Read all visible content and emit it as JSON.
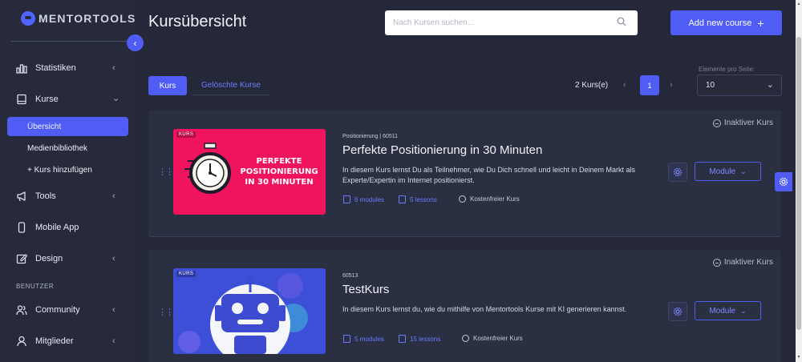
{
  "sidebar": {
    "logo": "MENTORTOOLS",
    "collapse_icon": "‹",
    "items": [
      {
        "label": "Statistiken",
        "icon": "bar-chart-icon",
        "chevron": "‹"
      },
      {
        "label": "Kurse",
        "icon": "book-icon",
        "chevron": "⌄"
      },
      {
        "label": "Tools",
        "icon": "megaphone-icon",
        "chevron": "‹"
      },
      {
        "label": "Mobile App",
        "icon": "smartphone-icon",
        "chevron": ""
      },
      {
        "label": "Design",
        "icon": "edit-icon",
        "chevron": "‹"
      },
      {
        "label": "Community",
        "icon": "users-icon",
        "chevron": "‹"
      },
      {
        "label": "Mitglieder",
        "icon": "user-icon",
        "chevron": "‹"
      }
    ],
    "sub_items": [
      {
        "label": "Übersicht"
      },
      {
        "label": "Medienbibliothek"
      },
      {
        "label": "+ Kurs hinzufügen"
      }
    ],
    "section_benutzer": "BENUTZER"
  },
  "header": {
    "title": "Kursübersicht",
    "search_placeholder": "Nach Kursen suchen...",
    "add_button": "Add new course",
    "add_icon": "+"
  },
  "tabs": [
    {
      "label": "Kurs"
    },
    {
      "label": "Gelöschte Kurse"
    }
  ],
  "pagination": {
    "count": "2 Kurs(e)",
    "prev": "‹",
    "page": "1",
    "next": "›",
    "per_page_label": "Elemente pro Seite:",
    "per_page_value": "10",
    "per_page_chevron": "⌄"
  },
  "courses": [
    {
      "tag": "KURS",
      "thumb_text": [
        "PERFEKTE",
        "POSITIONIERUNG",
        "IN 30 MINUTEN"
      ],
      "meta": "Positionierung | 60511",
      "title": "Perfekte Positionierung in 30 Minuten",
      "description": "In diesem Kurs lernst Du als Teilnehmer, wie Du Dich schnell und leicht in Deinem Markt als Experte/Expertin im Internet positionierst.",
      "modules": "6 modules",
      "lessons": "5 lessons",
      "price": "Kostenfreier Kurs",
      "status": "Inaktiver Kurs",
      "module_button": "Module",
      "colors": {
        "thumb_bg": "#f0145e"
      }
    },
    {
      "tag": "KURS",
      "thumb_text": [],
      "meta": "60513",
      "title": "TestKurs",
      "description": "In diesem Kurs lernst du, wie du mithilfe von Mentortools Kurse mit KI generieren kannst.",
      "modules": "5 modules",
      "lessons": "15 lessons",
      "price": "Kostenfreier Kurs",
      "status": "Inaktiver Kurs",
      "module_button": "Module",
      "colors": {
        "thumb_bg": "#3d4fd6"
      }
    }
  ],
  "colors": {
    "accent": "#4f5df4",
    "background": "#252838",
    "card": "#2b2f42"
  }
}
